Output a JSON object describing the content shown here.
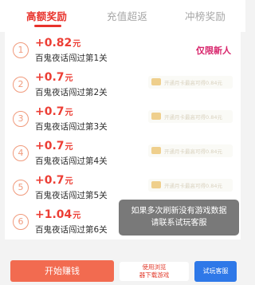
{
  "tabs": [
    {
      "label": "高额奖励",
      "active": true
    },
    {
      "label": "充值超返",
      "active": false
    },
    {
      "label": "冲榜奖励",
      "active": false
    }
  ],
  "rewards": [
    {
      "index": "1",
      "amount": "+0.82",
      "unit": "元",
      "description": "百鬼夜话闯过第1关",
      "badge": "仅限新人"
    },
    {
      "index": "2",
      "amount": "+0.7",
      "unit": "元",
      "description": "百鬼夜话闯过第2关",
      "pill_text": "开通月卡最高可得0.84元"
    },
    {
      "index": "3",
      "amount": "+0.7",
      "unit": "元",
      "description": "百鬼夜话闯过第3关",
      "pill_text": "开通月卡最高可得0.84元"
    },
    {
      "index": "4",
      "amount": "+0.7",
      "unit": "元",
      "description": "百鬼夜话闯过第4关",
      "pill_text": "开通月卡最高可得0.84元"
    },
    {
      "index": "5",
      "amount": "+0.7",
      "unit": "元",
      "description": "百鬼夜话闯过第5关",
      "pill_text": "开通月卡最高可得0.84元"
    },
    {
      "index": "6",
      "amount": "+1.04",
      "unit": "元",
      "description": "百鬼夜话闯过第6关"
    }
  ],
  "toast": {
    "line1": "如果多次刷新没有游戏数据",
    "line2": "请联系试玩客服"
  },
  "bottom": {
    "start_label": "开始赚钱",
    "mid_line1": "使用浏览",
    "mid_line2": "器下载游戏",
    "service_label": "试玩客服"
  },
  "colors": {
    "accent": "#e8322b",
    "newcomer_badge": "#d8246b",
    "service_button": "#2e78e8",
    "start_button": "#f26b50"
  }
}
